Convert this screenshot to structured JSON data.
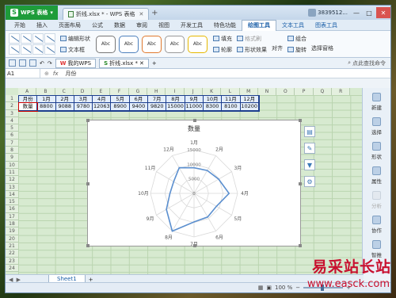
{
  "window": {
    "app_name": "WPS 表格",
    "tab_title": "折线.xlsx * - WPS 表格",
    "user_name": "3839512...",
    "min": "—",
    "max": "□",
    "close": "✕",
    "new_tab": "+"
  },
  "menu": [
    "开始",
    "插入",
    "页面布局",
    "公式",
    "数据",
    "审阅",
    "视图",
    "开发工具",
    "特色功能",
    "绘图工具",
    "文本工具",
    "图表工具"
  ],
  "menu_active_index": 9,
  "ribbon": {
    "edit_shape": "编辑形状",
    "text_box": "文本框",
    "style_label": "Abc",
    "fill": "填充",
    "outline": "轮廓",
    "format_brush": "格式刷",
    "shape_effect": "形状效果",
    "align": "对齐",
    "group": "组合",
    "rotate": "旋转",
    "select_pane": "选择窗格"
  },
  "quickbar": {
    "tab1": "我的WPS",
    "tab2": "折线.xlsx *",
    "add": "+",
    "search": "点此查找命令"
  },
  "formula": {
    "namebox": "A1",
    "fx": "fx",
    "content": "月份"
  },
  "columns": [
    "A",
    "B",
    "C",
    "D",
    "E",
    "F",
    "G",
    "H",
    "I",
    "J",
    "K",
    "L",
    "M",
    "N",
    "O",
    "P",
    "Q",
    "R"
  ],
  "rows": [
    "1",
    "2",
    "3",
    "4",
    "5",
    "6",
    "7",
    "8",
    "9",
    "10",
    "11",
    "12",
    "13",
    "14",
    "15",
    "16",
    "17",
    "18",
    "19",
    "20",
    "21",
    "22",
    "23",
    "24"
  ],
  "table": {
    "row1": [
      "月份",
      "1月",
      "2月",
      "3月",
      "4月",
      "5月",
      "6月",
      "7月",
      "8月",
      "9月",
      "10月",
      "11月",
      "12月"
    ],
    "row2": [
      "数量",
      "8800",
      "9088",
      "9780",
      "12063",
      "8900",
      "9400",
      "9820",
      "15000",
      "11000",
      "8300",
      "8100",
      "10200"
    ]
  },
  "chart_data": {
    "type": "radar",
    "title": "数量",
    "categories": [
      "1月",
      "2月",
      "3月",
      "4月",
      "5月",
      "6月",
      "7月",
      "8月",
      "9月",
      "10月",
      "11月",
      "12月"
    ],
    "series": [
      {
        "values": [
          8800,
          9088,
          9780,
          12063,
          8900,
          9400,
          9820,
          15000,
          11000,
          8300,
          8100,
          10200
        ]
      }
    ],
    "rlim": [
      0,
      15000
    ],
    "ticks": [
      "0",
      "5000",
      "10000",
      "15000"
    ],
    "series_color": "#5b8fcf"
  },
  "chart_tools": [
    "chart-elements",
    "chart-style",
    "chart-filter",
    "chart-settings"
  ],
  "right_panel": [
    "新建",
    "选择",
    "形状",
    "属性",
    "分析",
    "协作",
    "智推"
  ],
  "sheet": {
    "nav": "◀ ▶",
    "tab": "Sheet1",
    "add": "+"
  },
  "status": {
    "zoom": "100 %"
  },
  "watermark": {
    "text": "易采站长站",
    "url": "www.easck.com"
  }
}
